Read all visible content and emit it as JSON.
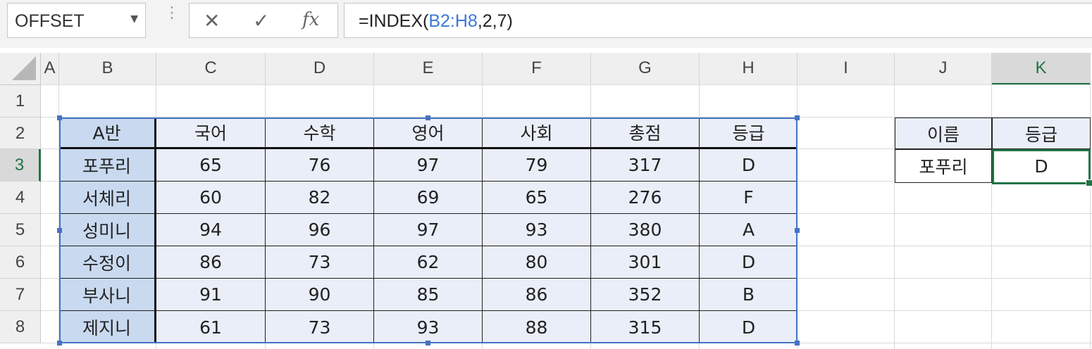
{
  "name_box": {
    "value": "OFFSET"
  },
  "formula_bar": {
    "prefix": "=INDEX(",
    "range": "B2:H8",
    "suffix": ",2,7)"
  },
  "columns": [
    "A",
    "B",
    "C",
    "D",
    "E",
    "F",
    "G",
    "H",
    "I",
    "J",
    "K"
  ],
  "rows": [
    "1",
    "2",
    "3",
    "4",
    "5",
    "6",
    "7",
    "8"
  ],
  "selected_column": "K",
  "selected_row": "3",
  "main_table": {
    "header": [
      "A반",
      "국어",
      "수학",
      "영어",
      "사회",
      "총점",
      "등급"
    ],
    "rows": [
      [
        "포푸리",
        "65",
        "76",
        "97",
        "79",
        "317",
        "D"
      ],
      [
        "서체리",
        "60",
        "82",
        "69",
        "65",
        "276",
        "F"
      ],
      [
        "성미니",
        "94",
        "96",
        "97",
        "93",
        "380",
        "A"
      ],
      [
        "수정이",
        "86",
        "73",
        "62",
        "80",
        "301",
        "D"
      ],
      [
        "부사니",
        "91",
        "90",
        "85",
        "86",
        "352",
        "B"
      ],
      [
        "제지니",
        "61",
        "73",
        "93",
        "88",
        "315",
        "D"
      ]
    ]
  },
  "lookup": {
    "name_label": "이름",
    "grade_label": "등급",
    "name_value": "포푸리",
    "grade_value": "D"
  },
  "colors": {
    "accent": "#217346",
    "table_name_fill": "#c9daf0",
    "table_fill": "#e9eef8",
    "range_ref": "#3c78d8"
  }
}
